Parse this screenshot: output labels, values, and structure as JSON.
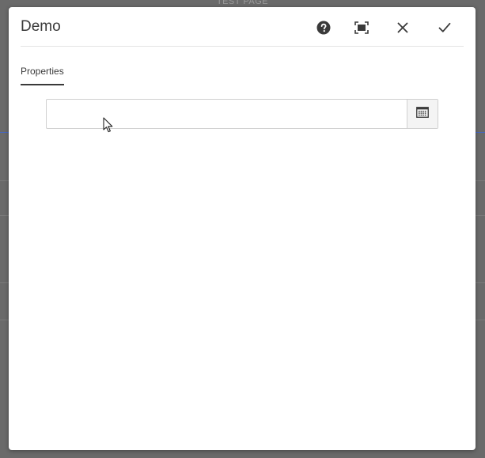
{
  "background_page": {
    "title": "TEST PAGE"
  },
  "dialog": {
    "title": "Demo",
    "buttons": {
      "help_icon": "help-icon",
      "fullscreen_icon": "fullscreen-icon",
      "close_icon": "close-icon",
      "confirm_icon": "check-icon"
    },
    "tabs": [
      {
        "label": "Properties",
        "active": true
      }
    ],
    "date_field": {
      "value": "",
      "placeholder": "",
      "button_icon": "calendar-icon"
    }
  },
  "colors": {
    "accent": "#4a67b8",
    "text": "#3a3a3a",
    "overlay": "#6a6a6a"
  }
}
